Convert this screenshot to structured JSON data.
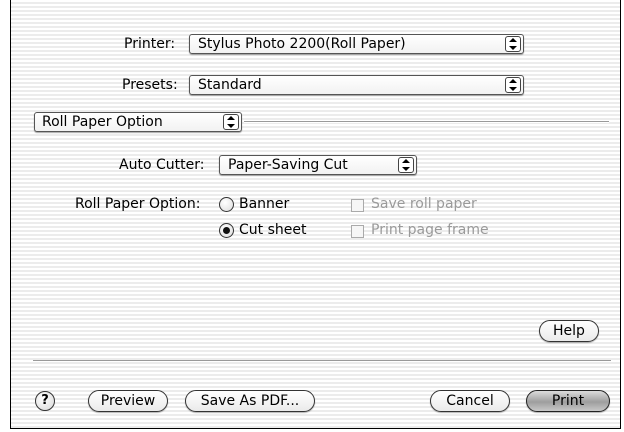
{
  "printer": {
    "label": "Printer:",
    "value": "Stylus Photo 2200(Roll Paper)"
  },
  "presets": {
    "label": "Presets:",
    "value": "Standard"
  },
  "panel_menu": {
    "value": "Roll Paper Option"
  },
  "auto_cutter": {
    "label": "Auto Cutter:",
    "value": "Paper-Saving Cut"
  },
  "roll_option": {
    "label": "Roll Paper Option:",
    "radios": [
      {
        "label": "Banner",
        "selected": false
      },
      {
        "label": "Cut sheet",
        "selected": true
      }
    ],
    "checkboxes": [
      {
        "label": "Save roll paper",
        "checked": false,
        "enabled": false
      },
      {
        "label": "Print page frame",
        "checked": false,
        "enabled": false
      }
    ]
  },
  "buttons": {
    "help": "Help",
    "help_icon": "?",
    "preview": "Preview",
    "save_pdf": "Save As PDF...",
    "cancel": "Cancel",
    "print": "Print"
  },
  "icons": {
    "popup_arrows": "up-down-arrows-icon",
    "help": "question-mark-icon"
  }
}
